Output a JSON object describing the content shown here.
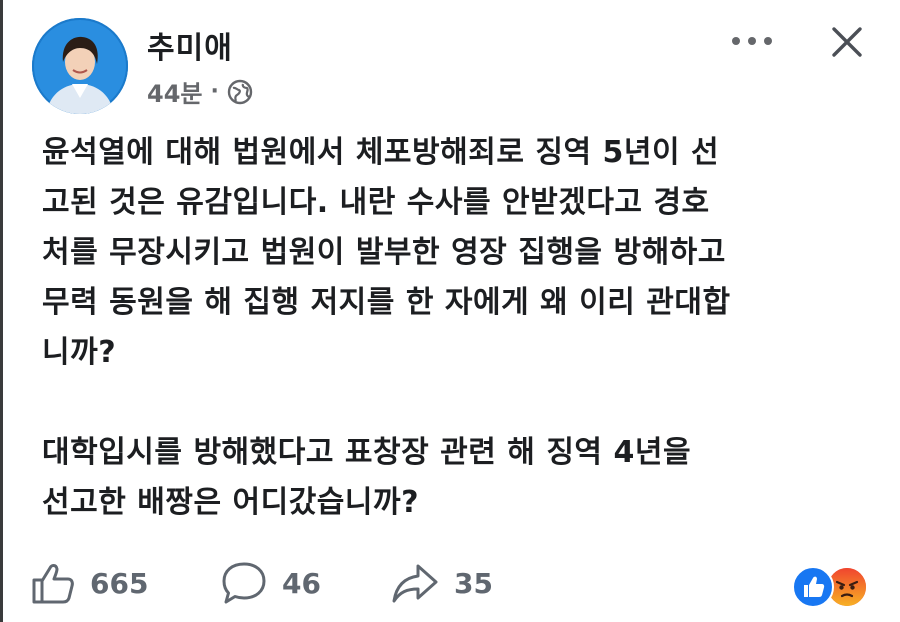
{
  "post": {
    "author": "추미애",
    "time": "44분",
    "separator": "·",
    "paragraphs": [
      "윤석열에 대해 법원에서 체포방해죄로 징역 5년이 선\n고된 것은 유감입니다. 내란  수사를 안받겠다고 경호\n처를 무장시키고 법원이 발부한 영장 집행을 방해하고\n무력 동원을 해 집행 저지를 한 자에게 왜 이리 관대합\n니까?",
      "대학입시를 방해했다고 표창장 관련 해  징역 4년을\n선고한 배짱은 어디갔습니까?"
    ]
  },
  "actions": {
    "like_count": "665",
    "comment_count": "46",
    "share_count": "35"
  },
  "icons": {
    "avatar": "profile-photo",
    "audience": "globe-icon",
    "more": "more-horizontal-icon",
    "close": "close-icon",
    "like": "thumbs-up-icon",
    "comment": "comment-bubble-icon",
    "share": "share-arrow-icon",
    "reactions": [
      "like-reaction-icon",
      "angry-reaction-icon"
    ]
  },
  "colors": {
    "text": "#1c1e21",
    "secondary": "#65676b",
    "action": "#606770",
    "like_blue": "#1877f2",
    "angry": "#f0563a"
  }
}
